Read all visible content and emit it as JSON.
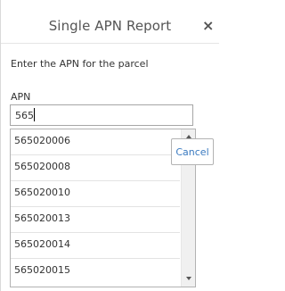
{
  "dialog": {
    "title": "Single APN Report",
    "close_glyph": "×"
  },
  "form": {
    "instructions": "Enter the APN for the parcel",
    "apn_label": "APN",
    "apn_value": "565"
  },
  "dropdown": {
    "items": [
      "565020006",
      "565020008",
      "565020010",
      "565020013",
      "565020014",
      "565020015"
    ]
  },
  "buttons": {
    "cancel_label": "Cancel"
  },
  "icons": {
    "close": "close-icon",
    "scroll_up": "chevron-up-icon",
    "scroll_down": "chevron-down-icon"
  }
}
